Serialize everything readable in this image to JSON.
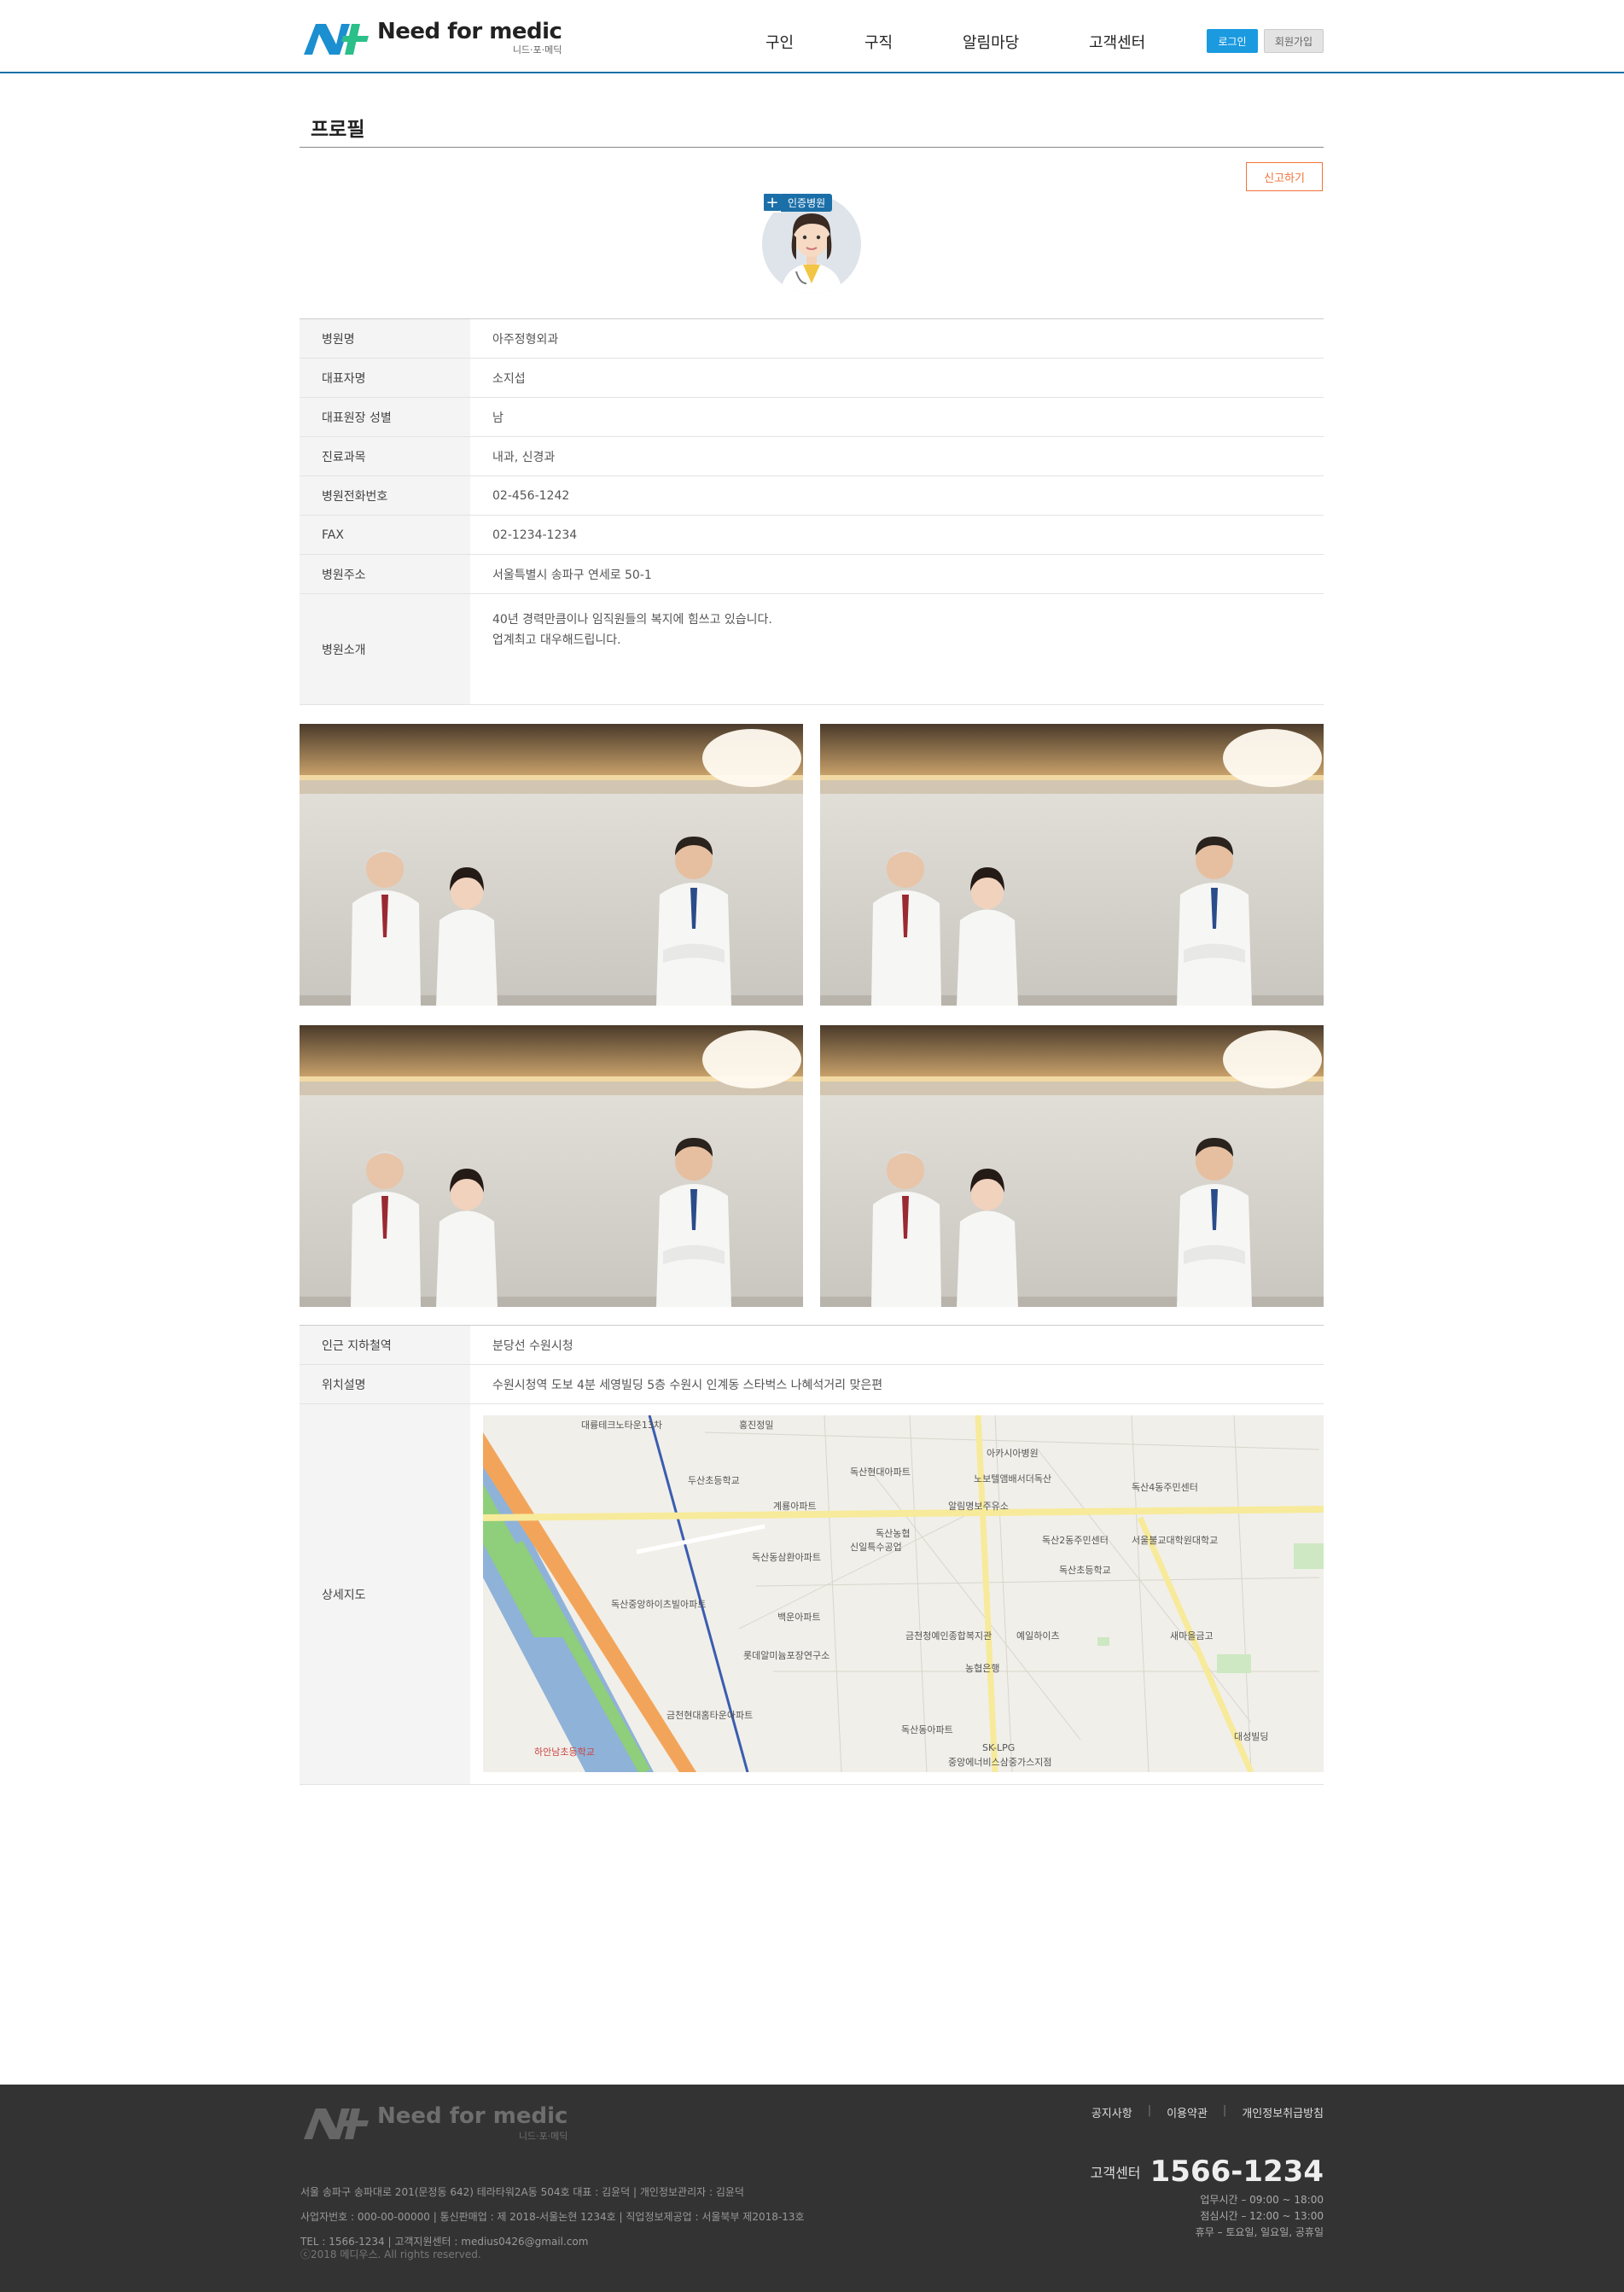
{
  "header": {
    "logo_main": "Need for medic",
    "logo_sub": "니드·포·메딕",
    "nav": [
      "구인",
      "구직",
      "알림마당",
      "고객센터"
    ],
    "login": "로그인",
    "join": "회원가입"
  },
  "profile": {
    "title": "프로필",
    "report": "신고하기",
    "badge": "인증병원"
  },
  "info": [
    {
      "label": "병원명",
      "value": "아주정형외과"
    },
    {
      "label": "대표자명",
      "value": "소지섭"
    },
    {
      "label": "대표원장 성별",
      "value": "남"
    },
    {
      "label": "진료과목",
      "value": "내과, 신경과"
    },
    {
      "label": "병원전화번호",
      "value": "02-456-1242"
    },
    {
      "label": "FAX",
      "value": "02-1234-1234"
    },
    {
      "label": "병원주소",
      "value": "서울특별시 송파구 연세로 50-1"
    }
  ],
  "intro": {
    "label": "병원소개",
    "line1": "40년 경력만큼이나 임직원들의 복지에 힘쓰고 있습니다.",
    "line2": "업계최고 대우해드립니다."
  },
  "location": {
    "subway_label": "인근 지하철역",
    "subway_value": "분당선 수원시청",
    "desc_label": "위치설명",
    "desc_value": "수원시청역 도보 4분 세영빌딩 5층 수원시 인계동 스타벅스 나혜석거리 맞은편",
    "map_label": "상세지도"
  },
  "map_labels": [
    "두산초등학교",
    "계룡아파트",
    "독산현대아파트",
    "아카시아병원",
    "노보텔앰배서더독산",
    "알림명보주유소",
    "독산4동주민센터",
    "독산농협",
    "신일특수공업",
    "독산동삼환아파트",
    "독산2동주민센터",
    "서울불교대학원대학교",
    "독산초등학교",
    "백운아파트",
    "금천청예인종합복지관",
    "예일하이츠",
    "새마을금고",
    "농협은행",
    "롯데알미늄포장연구소",
    "독산중앙하이츠빌아파트",
    "금천현대홈타운아파트",
    "독산동아파트",
    "SK-LPG",
    "하안남초등학교",
    "대성빌딩",
    "홍진정밀",
    "대륭테크노타운13차",
    "중앙에너비스삼중가스지점"
  ],
  "footer": {
    "logo_main": "Need for medic",
    "logo_sub": "니드·포·메딕",
    "links": [
      "공지사항",
      "이용약관",
      "개인정보취급방침"
    ],
    "addr": "서울 송파구 송파대로 201(문정동 642) 테라타워2A동 504호  대표 : 김윤덕  |  개인정보관리자 : 김윤덕",
    "biz": "사업자번호 : 000-00-00000  |  통신판매업 : 제 2018-서울논현 1234호  |  직업정보제공업 : 서울북부 제2018-13호",
    "tel": "TEL : 1566-1234  |  고객지원센터 : medius0426@gmail.com",
    "copy": "ⓒ2018 메디우스. All rights reserved.",
    "cs_label": "고객센터",
    "cs_number": "1566-1234",
    "hours1": "업무시간 – 09:00 ~ 18:00",
    "hours2": "점심시간 – 12:00 ~ 13:00",
    "hours3": "휴무 – 토요일, 일요일, 공휴일"
  }
}
